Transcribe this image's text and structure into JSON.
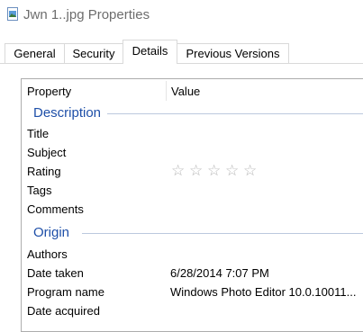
{
  "window": {
    "title": "Jwn 1..jpg Properties",
    "icon": "image-file-icon"
  },
  "tabs": [
    {
      "label": "General",
      "active": false
    },
    {
      "label": "Security",
      "active": false
    },
    {
      "label": "Details",
      "active": true
    },
    {
      "label": "Previous Versions",
      "active": false
    }
  ],
  "details": {
    "columns": {
      "property": "Property",
      "value": "Value"
    },
    "groups": [
      {
        "name": "Description",
        "rows": [
          {
            "property": "Title",
            "value": ""
          },
          {
            "property": "Subject",
            "value": ""
          },
          {
            "property": "Rating",
            "value": "",
            "stars_filled": 0,
            "stars_total": 5
          },
          {
            "property": "Tags",
            "value": ""
          },
          {
            "property": "Comments",
            "value": ""
          }
        ]
      },
      {
        "name": "Origin",
        "rows": [
          {
            "property": "Authors",
            "value": ""
          },
          {
            "property": "Date taken",
            "value": "6/28/2014 7:07 PM"
          },
          {
            "property": "Program name",
            "value": "Windows Photo Editor 10.0.10011..."
          },
          {
            "property": "Date acquired",
            "value": ""
          }
        ]
      }
    ]
  },
  "colors": {
    "group_heading": "#1e4fa8",
    "title_text": "#6d6d6d",
    "star_empty": "#b7b7b7"
  }
}
